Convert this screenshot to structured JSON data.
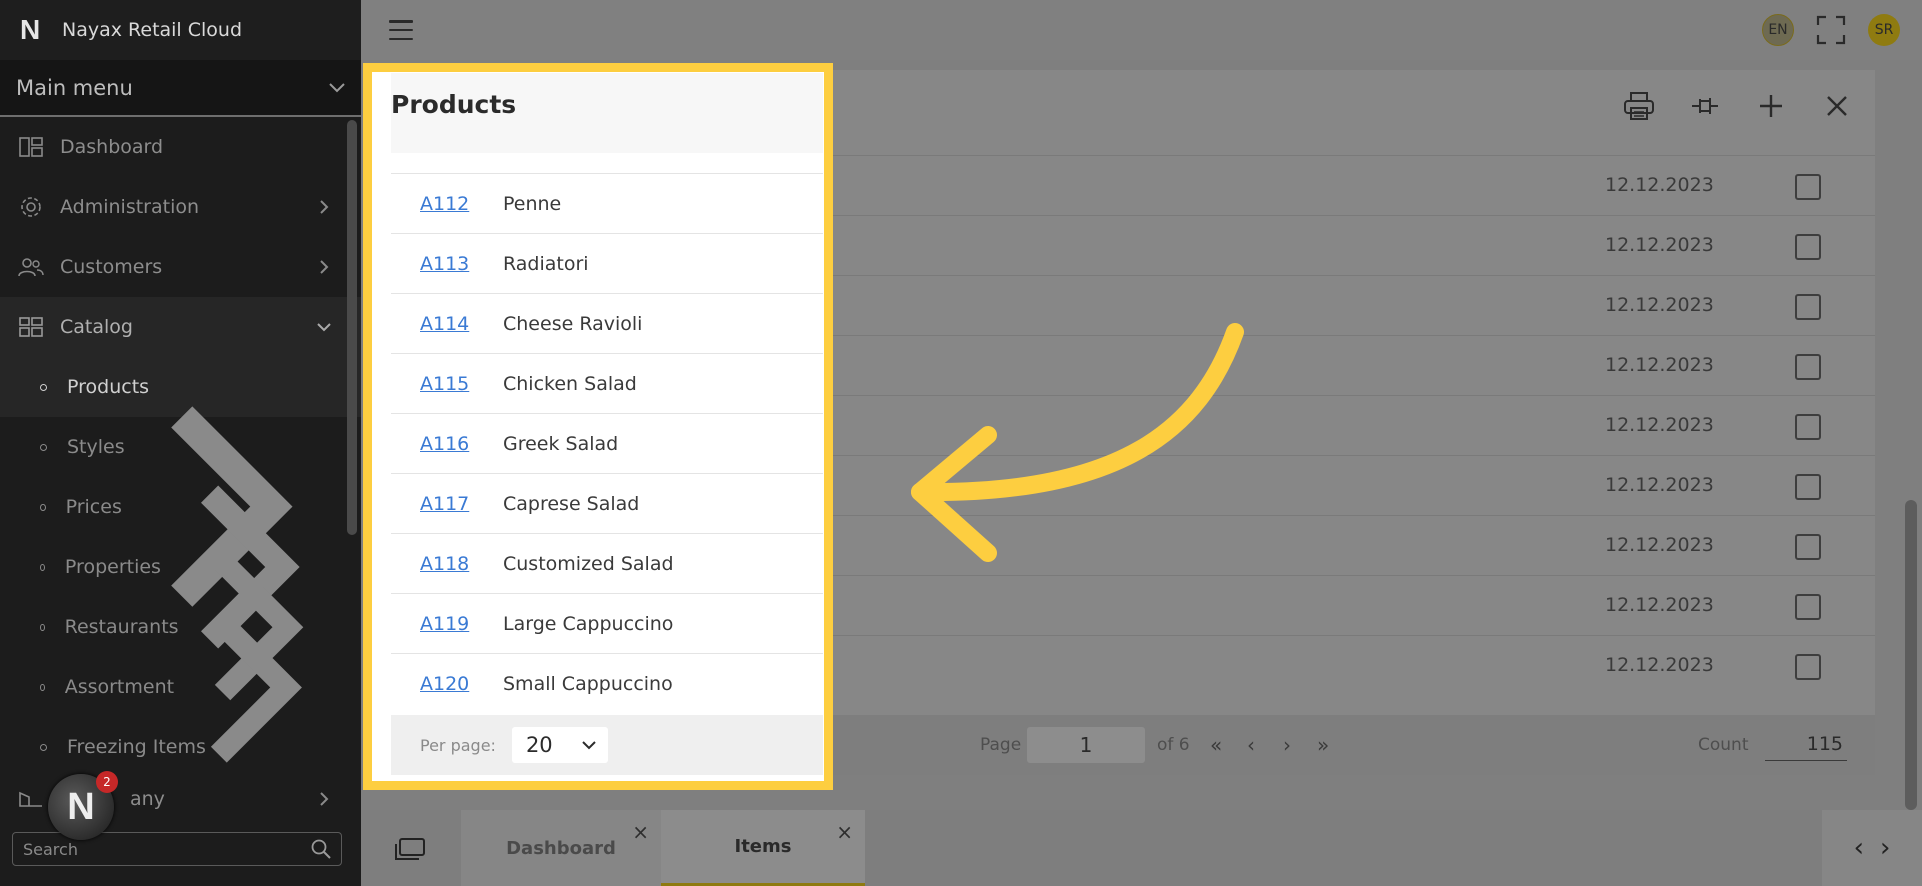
{
  "app": {
    "title": "Nayax Retail Cloud",
    "logo_letter": "N"
  },
  "sidebar": {
    "main_menu_label": "Main menu",
    "items": [
      {
        "label": "Dashboard",
        "icon": "dashboard-icon",
        "has_arrow": false
      },
      {
        "label": "Administration",
        "icon": "gear-icon",
        "has_arrow": true
      },
      {
        "label": "Customers",
        "icon": "users-icon",
        "has_arrow": true
      },
      {
        "label": "Catalog",
        "icon": "grid-icon",
        "expanded": true
      }
    ],
    "catalog_subitems": [
      {
        "label": "Products",
        "active": true
      },
      {
        "label": "Styles"
      },
      {
        "label": "Prices"
      },
      {
        "label": "Properties"
      },
      {
        "label": "Restaurants"
      },
      {
        "label": "Assortment"
      },
      {
        "label": "Freezing Items"
      }
    ],
    "partial_item_label": "any",
    "search_placeholder": "Search",
    "notification_count": "2"
  },
  "topbar": {
    "language": "EN",
    "user_initials": "SR"
  },
  "products_panel": {
    "title": "Products",
    "rows": [
      {
        "code": "A112",
        "name": "Penne"
      },
      {
        "code": "A113",
        "name": "Radiatori"
      },
      {
        "code": "A114",
        "name": "Cheese Ravioli"
      },
      {
        "code": "A115",
        "name": "Chicken Salad"
      },
      {
        "code": "A116",
        "name": "Greek Salad"
      },
      {
        "code": "A117",
        "name": "Caprese Salad"
      },
      {
        "code": "A118",
        "name": "Customized Salad"
      },
      {
        "code": "A119",
        "name": "Large Cappuccino"
      },
      {
        "code": "A120",
        "name": "Small Cappuccino"
      }
    ],
    "per_page_label": "Per page:",
    "per_page_value": "20"
  },
  "table_bg": {
    "dates": [
      "12.12.2023",
      "12.12.2023",
      "12.12.2023",
      "12.12.2023",
      "12.12.2023",
      "12.12.2023",
      "12.12.2023",
      "12.12.2023",
      "12.12.2023"
    ],
    "page_label": "Page",
    "page_value": "1",
    "page_of": "of 6",
    "count_label": "Count",
    "count_value": "115"
  },
  "tabs": [
    {
      "label": "Dashboard",
      "active": false
    },
    {
      "label": "Items",
      "active": true
    }
  ],
  "colors": {
    "highlight": "#fdce40",
    "link": "#3a7ad4",
    "sidebar_bg": "#1c1c1c"
  }
}
